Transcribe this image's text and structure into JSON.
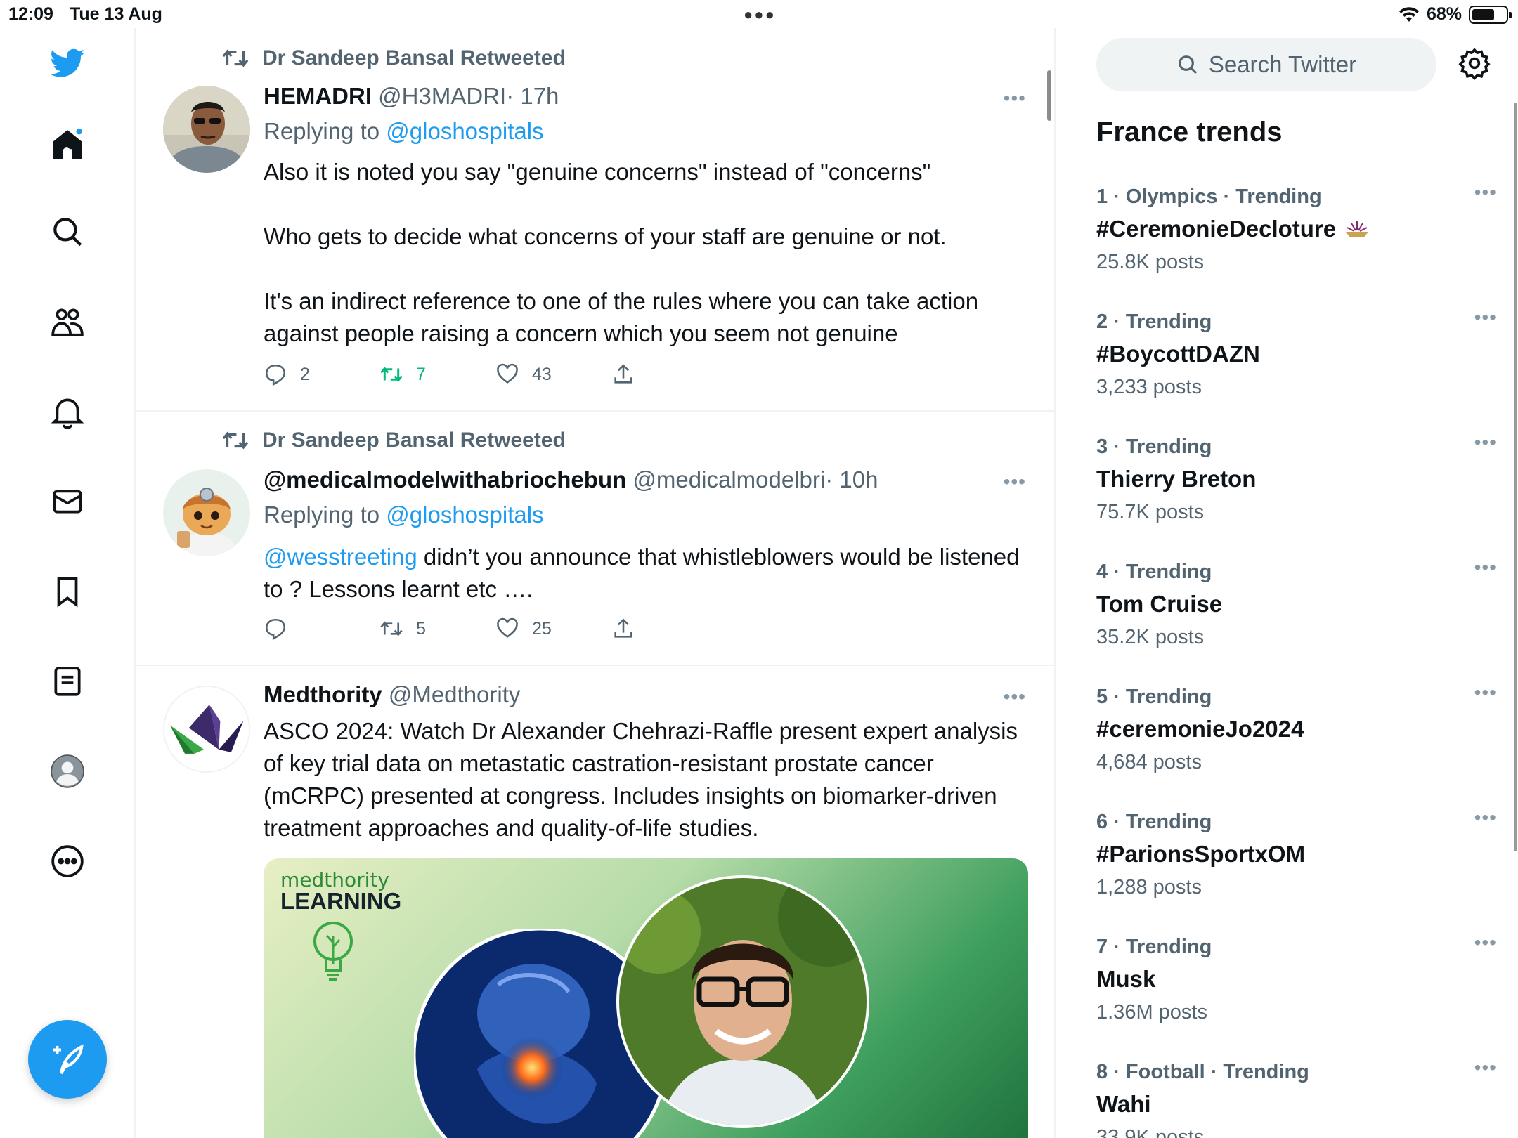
{
  "status_bar": {
    "time": "12:09",
    "date": "Tue 13 Aug",
    "battery": "68%",
    "battery_level": 0.68
  },
  "nav": {
    "items": [
      "twitter-logo-icon",
      "home-icon",
      "search-icon",
      "communities-icon",
      "notifications-icon",
      "messages-icon",
      "bookmarks-icon",
      "lists-icon",
      "profile-icon",
      "more-icon"
    ],
    "compose_icon": "compose-icon"
  },
  "colors": {
    "accent": "#1d9bf0",
    "retweet_green": "#00ba7c",
    "secondary_text": "#536471"
  },
  "timeline": {
    "tweets": [
      {
        "retweeted_by": "Dr Sandeep Bansal Retweeted",
        "name": "HEMADRI",
        "handle": "@H3MADRI",
        "time": "· 17h",
        "replying_prefix": "Replying to",
        "replying_to": "@gloshospitals",
        "paragraphs": [
          "Also it is noted you say \"genuine concerns\" instead of \"concerns\"",
          "Who gets to decide what concerns of your staff are genuine or not.",
          "It's an indirect reference to one of the rules where you can take action against people raising a concern which you seem not genuine"
        ],
        "replies": "2",
        "retweets": "7",
        "likes": "43"
      },
      {
        "retweeted_by": "Dr Sandeep Bansal Retweeted",
        "name": "@medicalmodelwithabriochebun",
        "handle": "@medicalmodelbri",
        "time": "· 10h",
        "replying_prefix": "Replying to",
        "replying_to": "@gloshospitals",
        "mention": "@wesstreeting",
        "text": " didn’t you announce that whistleblowers would be listened to ? Lessons learnt etc ….",
        "replies": "",
        "retweets": "5",
        "likes": "25"
      },
      {
        "name": "Medthority",
        "handle": "@Medthority",
        "text": "ASCO 2024: Watch Dr Alexander Chehrazi-Raffle present expert analysis of key trial data on metastatic castration-resistant prostate cancer (mCRPC) presented at congress. Includes insights on biomarker-driven treatment approaches and quality-of-life studies.",
        "media_brand_a": "medthority",
        "media_brand_b": "LEARNING"
      }
    ]
  },
  "sidebar": {
    "search_placeholder": "Search Twitter",
    "trends_title": "France trends",
    "trends": [
      {
        "meta": "1 · Olympics · Trending",
        "name": "#CeremonieDecloture",
        "posts": "25.8K posts"
      },
      {
        "meta": "2 · Trending",
        "name": "#BoycottDAZN",
        "posts": "3,233 posts"
      },
      {
        "meta": "3 · Trending",
        "name": "Thierry Breton",
        "posts": "75.7K posts"
      },
      {
        "meta": "4 · Trending",
        "name": "Tom Cruise",
        "posts": "35.2K posts"
      },
      {
        "meta": "5 · Trending",
        "name": "#ceremonieJo2024",
        "posts": "4,684 posts"
      },
      {
        "meta": "6 · Trending",
        "name": "#ParionsSportxOM",
        "posts": "1,288 posts"
      },
      {
        "meta": "7 · Trending",
        "name": "Musk",
        "posts": "1.36M posts"
      },
      {
        "meta": "8 · Football · Trending",
        "name": "Wahi",
        "posts": "33.9K posts"
      }
    ]
  }
}
